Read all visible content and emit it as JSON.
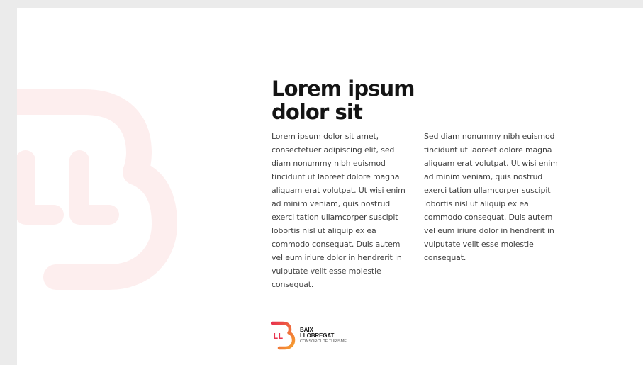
{
  "heading": "Lorem ipsum dolor sit",
  "columns": {
    "left": "Lorem ipsum dolor sit amet, consectetuer adipiscing elit, sed diam nonummy nibh euismod tincidunt ut laoreet dolore magna aliquam erat volutpat. Ut wisi enim ad minim veniam, quis nostrud exerci tation ullamcorper suscipit lobortis nisl ut aliquip ex ea commodo consequat. Duis autem vel eum iriure dolor in hendrerit in vulputate velit esse molestie consequat.",
    "right": "Sed diam nonummy nibh euismod tincidunt ut laoreet dolore magna aliquam erat volutpat. Ut wisi enim ad minim veniam, quis nostrud exerci tation ullamcorper suscipit lobortis nisl ut aliquip ex ea commodo consequat. Duis autem vel eum iriure dolor in hendrerit in vulputate velit esse molestie consequat."
  },
  "logo": {
    "mark_letters": "LL",
    "line1": "BAIX",
    "line2": "LLOBREGAT",
    "subtitle": "CONSORCI DE TURISME"
  },
  "colors": {
    "page_background": "#ebebeb",
    "document_background": "#ffffff",
    "watermark": "#fdeeee",
    "logo_gradient_start": "#e8344e",
    "logo_gradient_end": "#f6a02d",
    "heading": "#141414",
    "body_text": "#404040"
  },
  "icons": {
    "watermark": "baix-llobregat-b-watermark-icon",
    "logo": "baix-llobregat-logo-icon"
  }
}
